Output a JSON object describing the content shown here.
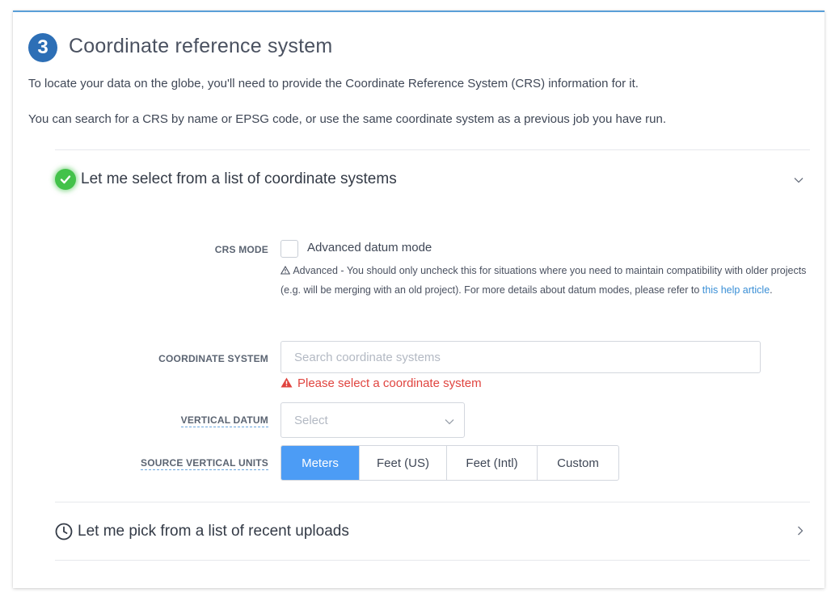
{
  "step": {
    "number": "3",
    "title": "Coordinate reference system"
  },
  "intro": {
    "p1": "To locate your data on the globe, you'll need to provide the Coordinate Reference System (CRS) information for it.",
    "p2": "You can search for a CRS by name or EPSG code, or use the same coordinate system as a previous job you have run."
  },
  "accordion_select": {
    "label": "Let me select from a list of coordinate systems",
    "expanded": true
  },
  "crs_mode": {
    "label": "CRS MODE",
    "checkbox_label": "Advanced datum mode",
    "checked": false,
    "help_prefix": "Advanced - You should only uncheck this for situations where you need to maintain compatibility with older projects (e.g. will be merging with an old project). For more details about datum modes, please refer to ",
    "help_link": "this help article",
    "help_suffix": "."
  },
  "coordinate_system": {
    "label": "COORDINATE SYSTEM",
    "placeholder": "Search coordinate systems",
    "value": "",
    "error": "Please select a coordinate system"
  },
  "vertical_datum": {
    "label": "VERTICAL DATUM",
    "placeholder": "Select"
  },
  "source_vertical_units": {
    "label": "SOURCE VERTICAL UNITS",
    "options": [
      "Meters",
      "Feet (US)",
      "Feet (Intl)",
      "Custom"
    ],
    "selected": "Meters"
  },
  "accordion_recent": {
    "label": "Let me pick from a list of recent uploads",
    "expanded": false
  },
  "colors": {
    "accent": "#4c9cf5",
    "badge": "#2d6fb6",
    "success": "#43c24a",
    "error": "#e0443f",
    "link": "#3a8fd6"
  }
}
